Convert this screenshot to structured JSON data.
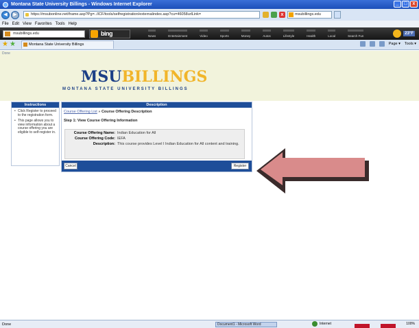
{
  "window": {
    "title": "Montana State University Billings - Windows Internet Explorer",
    "controls": [
      "_",
      "□",
      "x"
    ]
  },
  "address_bar": {
    "url": "https://msubonline.net/frame.asp?Pg=../ICF/tools/selfregistration/externalindex.asp?cu=46058urlLink=",
    "search_value": "msubillings.edu"
  },
  "menu": {
    "items": [
      "File",
      "Edit",
      "View",
      "Favorites",
      "Tools",
      "Help"
    ]
  },
  "bing_toolbar": {
    "site_dropdown": "msubillings.edu",
    "logo": "bing",
    "nav": [
      "News",
      "Entertainment",
      "Video",
      "Sports",
      "Money",
      "Autos",
      "Lifestyle",
      "Health",
      "Local",
      "Search Fun"
    ],
    "temperature": "23°F"
  },
  "tabs": {
    "active": "Montana State University Billings",
    "commands": [
      "Page ▾",
      "Tools ▾"
    ]
  },
  "page": {
    "top_status": "Done",
    "logo": {
      "line1_msu": "MSU",
      "line1_billings": "BILLINGS",
      "line2_montana": "MONTANA STATE UNIVERSITY",
      "line2_billings": "BILLINGS"
    },
    "instructions": {
      "header": "Instructions",
      "items": [
        "Click Register to proceed to the registration form.",
        "This page allows you to view information about a course offering you are eligible to self-register in."
      ]
    },
    "description": {
      "header": "Description",
      "breadcrumb_link": "Course Offering List",
      "breadcrumb_sep": " » ",
      "breadcrumb_current": "Course Offering Description",
      "step": "Step 1: View Course Offering Information",
      "fields": {
        "name_label": "Course Offering Name:",
        "name_value": "Indian Education for All",
        "code_label": "Course Offering Code:",
        "code_value": "IEFA",
        "desc_label": "Description:",
        "desc_value": "This course provides Level I Indian Education for All content and training."
      },
      "cancel_label": "Cancel",
      "register_label": "Register"
    }
  },
  "status_bar": {
    "status": "Done",
    "taskbar_item": "Document1 - Microsoft Word",
    "zone": "Internet",
    "zoom": "100%"
  },
  "colors": {
    "panel_header": "#1e4e99",
    "banner": "#f2f3dc",
    "msu_blue": "#1c3f86",
    "gold": "#f1b52a",
    "arrow": "#d98b8b"
  }
}
